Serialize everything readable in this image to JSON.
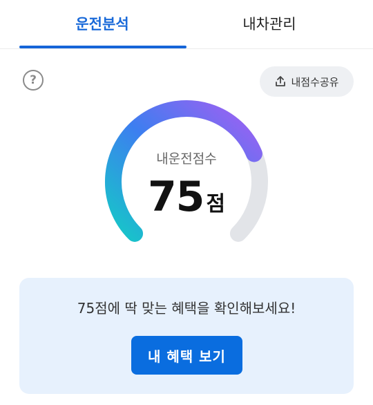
{
  "tabs": [
    {
      "label": "운전분석",
      "active": true
    },
    {
      "label": "내차관리",
      "active": false
    }
  ],
  "help": {
    "glyph": "?"
  },
  "share": {
    "label": "내점수공유",
    "icon": "share-upload-icon"
  },
  "gauge": {
    "label": "내운전점수",
    "score": "75",
    "unit": "점",
    "value_fraction": 0.75,
    "colors": {
      "start": "#16c7c8",
      "mid": "#3d7ef0",
      "end": "#a35ff2",
      "track": "#e2e4e8"
    }
  },
  "promo": {
    "text": "75점에 딱 맞는 혜택을 확인해보세요!",
    "button_label": "내 혜택 보기",
    "accent": "#0a6ddf"
  }
}
